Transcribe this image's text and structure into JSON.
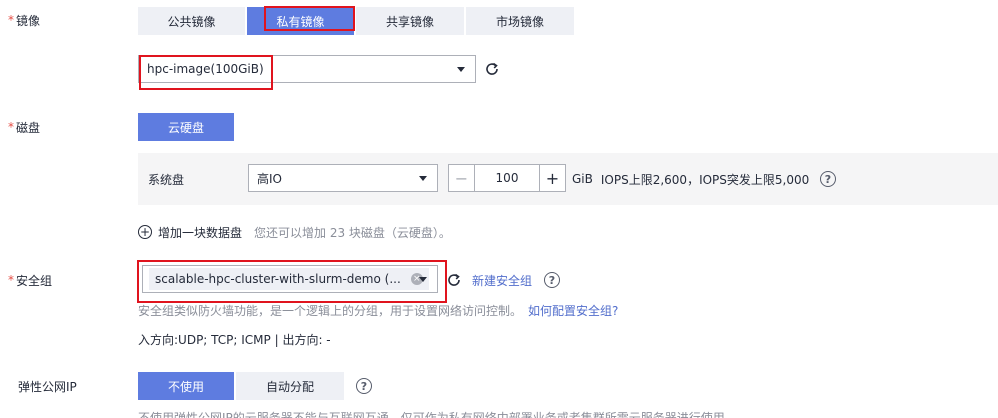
{
  "image": {
    "label": "镜像",
    "tabs": [
      "公共镜像",
      "私有镜像",
      "共享镜像",
      "市场镜像"
    ],
    "active_tab": "私有镜像",
    "selected": "hpc-image(100GiB)"
  },
  "disk": {
    "label": "磁盘",
    "type_button": "云硬盘",
    "system_disk_label": "系统盘",
    "disk_type": "高IO",
    "size": "100",
    "unit": "GiB",
    "iops_text": "IOPS上限2,600，IOPS突发上限5,000",
    "add_disk": "增加一块数据盘",
    "add_disk_hint": "您还可以增加 23 块磁盘（云硬盘）。"
  },
  "security_group": {
    "label": "安全组",
    "selected": "scalable-hpc-cluster-with-slurm-demo (...",
    "new_link": "新建安全组",
    "desc": "安全组类似防火墙功能，是一个逻辑上的分组，用于设置网络访问控制。",
    "how_link": "如何配置安全组?",
    "rules": "入方向:UDP; TCP; ICMP | 出方向: -"
  },
  "eip": {
    "label": "弹性公网IP",
    "options": [
      "不使用",
      "自动分配"
    ],
    "active": "不使用",
    "desc": "不使用弹性公网IP的云服务器不能与互联网互通，仅可作为私有网络中部署业务或者集群所需云服务器进行使用。"
  },
  "colors": {
    "accent": "#5e7ce0",
    "highlight": "#e0141e",
    "required": "#e44d45"
  }
}
